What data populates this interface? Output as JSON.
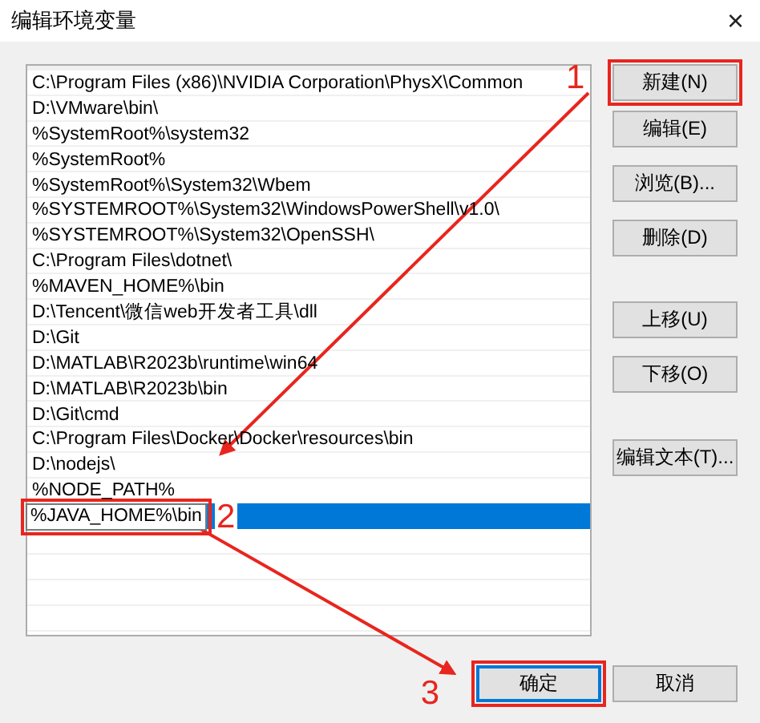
{
  "window": {
    "title": "编辑环境变量",
    "close": "×"
  },
  "paths": [
    {
      "text": "C:\\Program Files (x86)\\NVIDIA Corporation\\PhysX\\Common",
      "selected": false
    },
    {
      "text": "D:\\VMware\\bin\\",
      "selected": false
    },
    {
      "text": "%SystemRoot%\\system32",
      "selected": false
    },
    {
      "text": "%SystemRoot%",
      "selected": false
    },
    {
      "text": "%SystemRoot%\\System32\\Wbem",
      "selected": false
    },
    {
      "text": "%SYSTEMROOT%\\System32\\WindowsPowerShell\\v1.0\\",
      "selected": false
    },
    {
      "text": "%SYSTEMROOT%\\System32\\OpenSSH\\",
      "selected": false
    },
    {
      "text": "C:\\Program Files\\dotnet\\",
      "selected": false
    },
    {
      "text": "%MAVEN_HOME%\\bin",
      "selected": false
    },
    {
      "text": "D:\\Tencent\\微信web开发者工具\\dll",
      "selected": false
    },
    {
      "text": "D:\\Git",
      "selected": false
    },
    {
      "text": "D:\\MATLAB\\R2023b\\runtime\\win64",
      "selected": false
    },
    {
      "text": "D:\\MATLAB\\R2023b\\bin",
      "selected": false
    },
    {
      "text": "D:\\Git\\cmd",
      "selected": false
    },
    {
      "text": "C:\\Program Files\\Docker\\Docker\\resources\\bin",
      "selected": false
    },
    {
      "text": "D:\\nodejs\\",
      "selected": false
    },
    {
      "text": "%NODE_PATH%",
      "selected": false
    },
    {
      "text": "%JAVA_HOME%\\bin",
      "selected": true
    }
  ],
  "side_buttons": [
    "新建(N)",
    "编辑(E)",
    "浏览(B)...",
    "删除(D)",
    "上移(U)",
    "下移(O)",
    "编辑文本(T)..."
  ],
  "footer_buttons": [
    {
      "label": "确定",
      "default": true
    },
    {
      "label": "取消",
      "default": false
    }
  ],
  "annotations": [
    {
      "label": "1"
    },
    {
      "label": "2"
    },
    {
      "label": "3"
    }
  ]
}
